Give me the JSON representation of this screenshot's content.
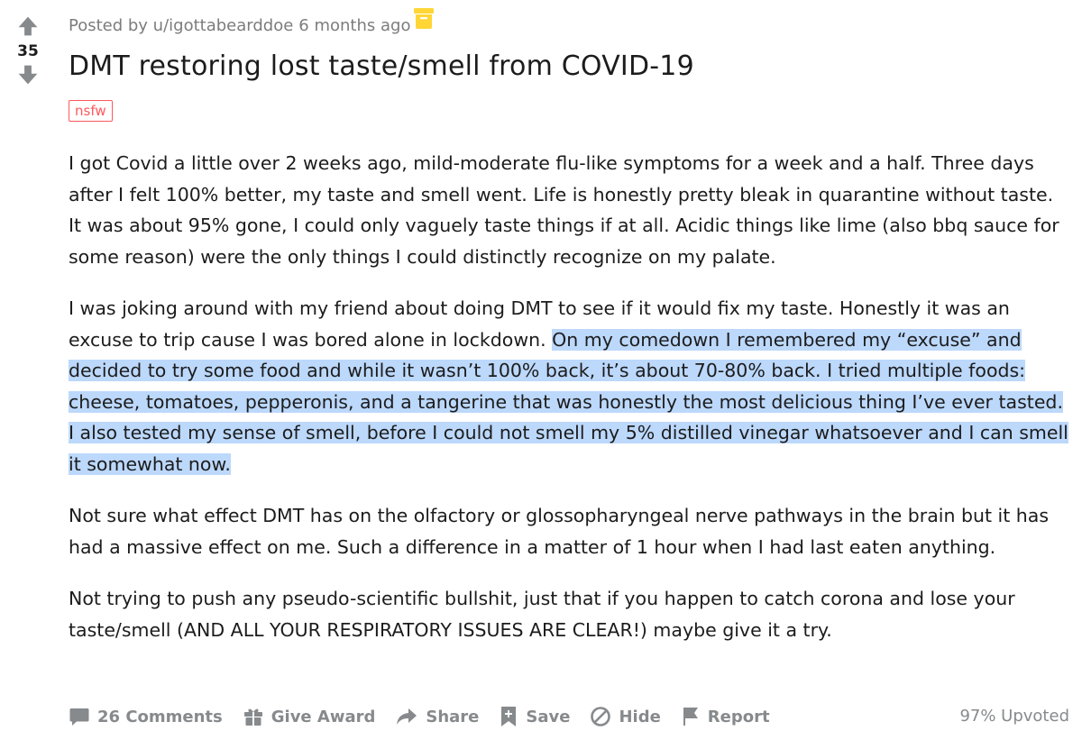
{
  "vote": {
    "score": "35"
  },
  "post": {
    "meta": {
      "posted_by": "Posted by u/igottabearddoe",
      "age": "6 months ago"
    },
    "title": "DMT restoring lost taste/smell from COVID-19",
    "flair": "nsfw",
    "paragraphs": [
      "I got Covid a little over 2 weeks ago, mild-moderate flu-like symptoms for a week and a half. Three days after I felt 100% better, my taste and smell went. Life is honestly pretty bleak in quarantine without taste. It was about 95% gone, I could only vaguely taste things if at all. Acidic things like lime (also bbq sauce for some reason) were the only things I could distinctly recognize on my palate.",
      {
        "plain": "I was joking around with my friend about doing DMT to see if it would fix my taste. Honestly it was an excuse to trip cause I was bored alone in lockdown. ",
        "highlighted": "On my comedown I remembered my “excuse” and decided to try some food and while it wasn’t 100% back, it’s about 70-80% back. I tried multiple foods: cheese, tomatoes, pepperonis, and a tangerine that was honestly the most delicious thing I’ve ever tasted. I also tested my sense of smell, before I could not smell my 5% distilled vinegar whatsoever and I can smell it somewhat now."
      },
      "Not sure what effect DMT has on the olfactory or glossopharyngeal nerve pathways in the brain but it has had a massive effect on me. Such a difference in a matter of 1 hour when I had last eaten anything.",
      "Not trying to push any pseudo-scientific bullshit, just that if you happen to catch corona and lose your taste/smell (AND ALL YOUR RESPIRATORY ISSUES ARE CLEAR!) maybe give it a try."
    ]
  },
  "actions": {
    "comments": "26 Comments",
    "award": "Give Award",
    "share": "Share",
    "save": "Save",
    "hide": "Hide",
    "report": "Report",
    "upvoted": "97% Upvoted"
  },
  "icons": {
    "upvote": "arrow-up-icon",
    "downvote": "arrow-down-icon",
    "archived": "archive-box-icon",
    "comments": "comment-bubble-icon",
    "award": "gift-icon",
    "share": "share-arrow-icon",
    "save": "bookmark-plus-icon",
    "hide": "hide-slash-icon",
    "report": "flag-icon"
  },
  "colors": {
    "vote_arrow": "#878a8c",
    "meta_text": "#7c7c7c",
    "nsfw": "#ff585b",
    "highlight": "#bcd8fb",
    "archive_icon": "#ffd635",
    "action_text": "#878a8c"
  }
}
